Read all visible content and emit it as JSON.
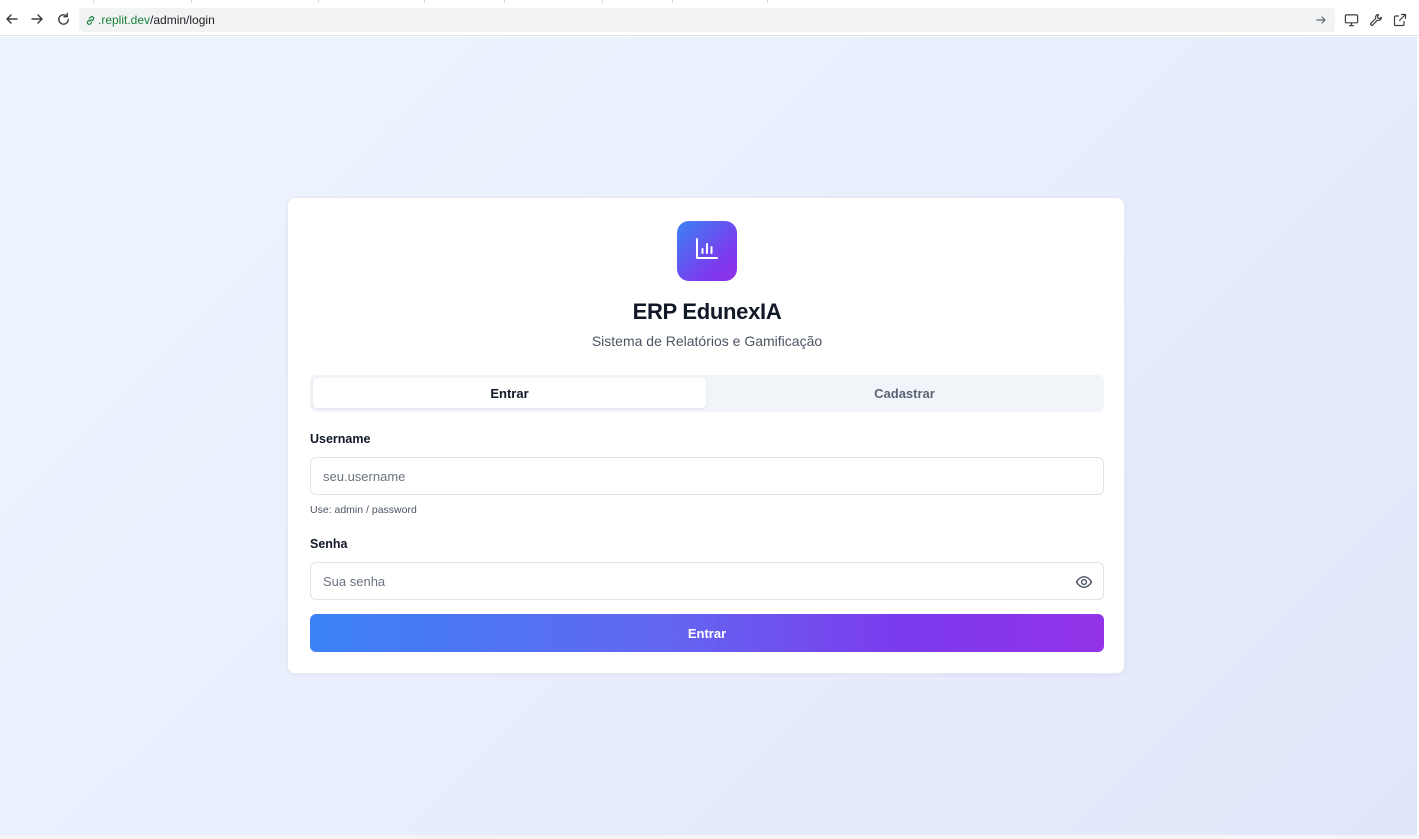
{
  "browser": {
    "url_domain": ".replit.dev",
    "url_path": "/admin/login",
    "icons": [
      "back-arrow-icon",
      "forward-arrow-icon",
      "reload-icon",
      "link-icon",
      "go-arrow-icon",
      "monitor-icon",
      "wrench-icon",
      "external-link-icon"
    ]
  },
  "login": {
    "logo_icon": "bar-chart-icon",
    "title": "ERP EdunexIA",
    "subtitle": "Sistema de Relatórios e Gamificação",
    "tabs": [
      {
        "label": "Entrar",
        "active": true
      },
      {
        "label": "Cadastrar",
        "active": false
      }
    ],
    "username": {
      "label": "Username",
      "placeholder": "seu.username",
      "value": "",
      "hint": "Use: admin / password"
    },
    "password": {
      "label": "Senha",
      "placeholder": "Sua senha",
      "value": "",
      "toggle_icon": "eye-icon"
    },
    "submit_label": "Entrar"
  },
  "colors": {
    "gradient_start": "#3b82f6",
    "gradient_end": "#9333ea",
    "background": "#e8eefc"
  }
}
